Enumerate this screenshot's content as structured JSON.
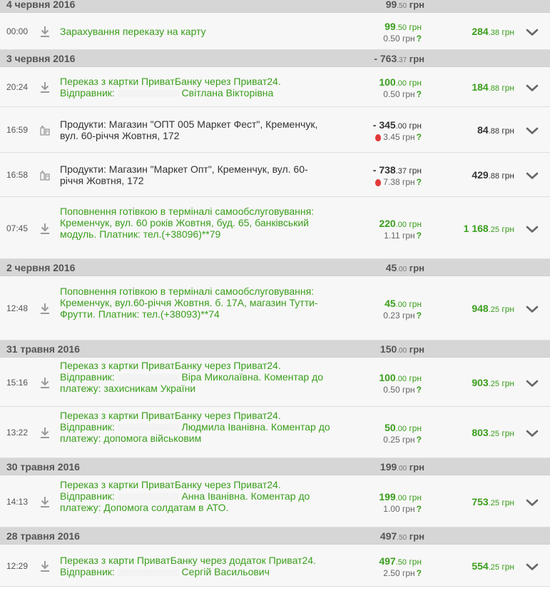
{
  "groups": [
    {
      "date": "4 червня 2016",
      "sum_int": "99",
      "sum_dec": ".50",
      "currency": "грн",
      "rows": [
        {
          "time": "00:00",
          "icon": "download-icon",
          "kind": "green",
          "parts": [
            "Зарахування переказу на карту"
          ],
          "amount_int": "99",
          "amount_dec": ".50",
          "fee": "0.50",
          "fee_icon": "",
          "balance_int": "284",
          "balance_dec": ".38",
          "balance_color": "green"
        }
      ]
    },
    {
      "date": "3 червня 2016",
      "sum_int": "- 763",
      "sum_dec": ".37",
      "currency": "грн",
      "rows": [
        {
          "time": "20:24",
          "icon": "download-icon",
          "kind": "green",
          "parts": [
            "Переказ з картки ПриватБанку через Приват24. Відправник: ",
            "#blur",
            " Світлана Вікторівна"
          ],
          "amount_int": "100",
          "amount_dec": ".00",
          "fee": "0.50",
          "fee_icon": "",
          "balance_int": "184",
          "balance_dec": ".88",
          "balance_color": "green"
        },
        {
          "time": "16:59",
          "icon": "grocery-icon",
          "kind": "dark",
          "parts": [
            "Продукти: Магазин \"ОПТ 005 Маркет Фест\", Кременчук, вул. 60-річчя Жовтня, 172"
          ],
          "amount_int": "- 345",
          "amount_dec": ".00",
          "fee": "3.45",
          "fee_icon": "strawberry-icon",
          "balance_int": "84",
          "balance_dec": ".88",
          "balance_color": "dark"
        },
        {
          "time": "16:58",
          "icon": "grocery-icon",
          "kind": "dark",
          "parts": [
            "Продукти: Магазин \"Маркет Опт\", Кременчук, вул. 60-річчя Жовтня, 172"
          ],
          "amount_int": "- 738",
          "amount_dec": ".37",
          "fee": "7.38",
          "fee_icon": "strawberry-icon",
          "balance_int": "429",
          "balance_dec": ".88",
          "balance_color": "dark"
        },
        {
          "time": "07:45",
          "icon": "download-icon",
          "kind": "green",
          "parts": [
            "Поповнення готівкою в терміналі самообслуговування: Кременчук, вул. 60 років Жовтня, буд. 65, банківський модуль. Платник: тел.(+38096)**79"
          ],
          "amount_int": "220",
          "amount_dec": ".00",
          "fee": "1.11",
          "fee_icon": "",
          "balance_int": "1 168",
          "balance_dec": ".25",
          "balance_color": "green"
        }
      ]
    },
    {
      "date": "2 червня 2016",
      "sum_int": "45",
      "sum_dec": ".00",
      "currency": "грн",
      "rows": [
        {
          "time": "12:48",
          "icon": "download-icon",
          "kind": "green",
          "parts": [
            "Поповнення готівкою в терміналі самообслуговування: Кременчук, вул.60-річчя Жовтня. б. 17А, магазин Тутти-Фрутти. Платник: тел.(+38093)**74"
          ],
          "amount_int": "45",
          "amount_dec": ".00",
          "fee": "0.23",
          "fee_icon": "",
          "balance_int": "948",
          "balance_dec": ".25",
          "balance_color": "green"
        }
      ]
    },
    {
      "date": "31 травня 2016",
      "sum_int": "150",
      "sum_dec": ".00",
      "currency": "грн",
      "rows": [
        {
          "time": "15:16",
          "icon": "download-icon",
          "kind": "green",
          "parts": [
            "Переказ з картки ПриватБанку через Приват24. Відправник: ",
            "#blur",
            " Віра Миколаївна. Коментар до платежу: захисникам України"
          ],
          "amount_int": "100",
          "amount_dec": ".00",
          "fee": "0.50",
          "fee_icon": "",
          "balance_int": "903",
          "balance_dec": ".25",
          "balance_color": "green"
        },
        {
          "time": "13:22",
          "icon": "download-icon",
          "kind": "green",
          "parts": [
            "Переказ з картки ПриватБанку через Приват24. Відправник: ",
            "#blur",
            " Людмила Іванівна. Коментар до платежу: допомога військовим"
          ],
          "amount_int": "50",
          "amount_dec": ".00",
          "fee": "0.25",
          "fee_icon": "",
          "balance_int": "803",
          "balance_dec": ".25",
          "balance_color": "green"
        }
      ]
    },
    {
      "date": "30 травня 2016",
      "sum_int": "199",
      "sum_dec": ".00",
      "currency": "грн",
      "rows": [
        {
          "time": "14:13",
          "icon": "download-icon",
          "kind": "green",
          "parts": [
            "Переказ з картки ПриватБанку через Приват24. Відправник: ",
            "#blur",
            " Анна Іванівна. Коментар до платежу: Допомога солдатам в АТО."
          ],
          "amount_int": "199",
          "amount_dec": ".00",
          "fee": "1.00",
          "fee_icon": "",
          "balance_int": "753",
          "balance_dec": ".25",
          "balance_color": "green"
        }
      ]
    },
    {
      "date": "28 травня 2016",
      "sum_int": "497",
      "sum_dec": ".50",
      "currency": "грн",
      "rows": [
        {
          "time": "12:29",
          "icon": "download-icon",
          "kind": "green",
          "parts": [
            "Переказ з карти ПриватБанку через додаток Приват24. Відправник: ",
            "#blur",
            " Сергій Васильович"
          ],
          "amount_int": "497",
          "amount_dec": ".50",
          "fee": "2.50",
          "fee_icon": "",
          "balance_int": "554",
          "balance_dec": ".25",
          "balance_color": "green"
        }
      ]
    }
  ],
  "colors": {
    "green": "#3a9e1c",
    "dark": "#333333",
    "header_bg": "#d6d6d6",
    "row_bg": "#f7f7f7"
  },
  "icons": {
    "expand": "chevron-down-icon",
    "help": "?"
  }
}
